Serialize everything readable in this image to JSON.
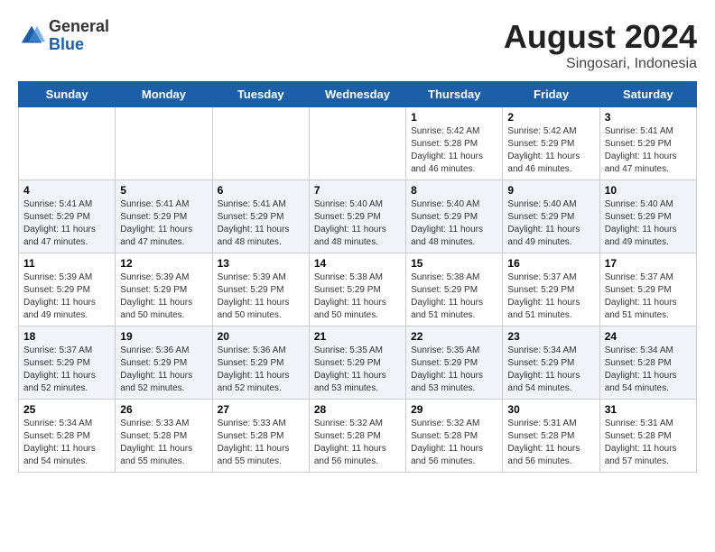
{
  "header": {
    "logo_general": "General",
    "logo_blue": "Blue",
    "month_title": "August 2024",
    "location": "Singosari, Indonesia"
  },
  "days_of_week": [
    "Sunday",
    "Monday",
    "Tuesday",
    "Wednesday",
    "Thursday",
    "Friday",
    "Saturday"
  ],
  "weeks": [
    [
      {
        "day": "",
        "info": ""
      },
      {
        "day": "",
        "info": ""
      },
      {
        "day": "",
        "info": ""
      },
      {
        "day": "",
        "info": ""
      },
      {
        "day": "1",
        "info": "Sunrise: 5:42 AM\nSunset: 5:28 PM\nDaylight: 11 hours and 46 minutes."
      },
      {
        "day": "2",
        "info": "Sunrise: 5:42 AM\nSunset: 5:29 PM\nDaylight: 11 hours and 46 minutes."
      },
      {
        "day": "3",
        "info": "Sunrise: 5:41 AM\nSunset: 5:29 PM\nDaylight: 11 hours and 47 minutes."
      }
    ],
    [
      {
        "day": "4",
        "info": "Sunrise: 5:41 AM\nSunset: 5:29 PM\nDaylight: 11 hours and 47 minutes."
      },
      {
        "day": "5",
        "info": "Sunrise: 5:41 AM\nSunset: 5:29 PM\nDaylight: 11 hours and 47 minutes."
      },
      {
        "day": "6",
        "info": "Sunrise: 5:41 AM\nSunset: 5:29 PM\nDaylight: 11 hours and 48 minutes."
      },
      {
        "day": "7",
        "info": "Sunrise: 5:40 AM\nSunset: 5:29 PM\nDaylight: 11 hours and 48 minutes."
      },
      {
        "day": "8",
        "info": "Sunrise: 5:40 AM\nSunset: 5:29 PM\nDaylight: 11 hours and 48 minutes."
      },
      {
        "day": "9",
        "info": "Sunrise: 5:40 AM\nSunset: 5:29 PM\nDaylight: 11 hours and 49 minutes."
      },
      {
        "day": "10",
        "info": "Sunrise: 5:40 AM\nSunset: 5:29 PM\nDaylight: 11 hours and 49 minutes."
      }
    ],
    [
      {
        "day": "11",
        "info": "Sunrise: 5:39 AM\nSunset: 5:29 PM\nDaylight: 11 hours and 49 minutes."
      },
      {
        "day": "12",
        "info": "Sunrise: 5:39 AM\nSunset: 5:29 PM\nDaylight: 11 hours and 50 minutes."
      },
      {
        "day": "13",
        "info": "Sunrise: 5:39 AM\nSunset: 5:29 PM\nDaylight: 11 hours and 50 minutes."
      },
      {
        "day": "14",
        "info": "Sunrise: 5:38 AM\nSunset: 5:29 PM\nDaylight: 11 hours and 50 minutes."
      },
      {
        "day": "15",
        "info": "Sunrise: 5:38 AM\nSunset: 5:29 PM\nDaylight: 11 hours and 51 minutes."
      },
      {
        "day": "16",
        "info": "Sunrise: 5:37 AM\nSunset: 5:29 PM\nDaylight: 11 hours and 51 minutes."
      },
      {
        "day": "17",
        "info": "Sunrise: 5:37 AM\nSunset: 5:29 PM\nDaylight: 11 hours and 51 minutes."
      }
    ],
    [
      {
        "day": "18",
        "info": "Sunrise: 5:37 AM\nSunset: 5:29 PM\nDaylight: 11 hours and 52 minutes."
      },
      {
        "day": "19",
        "info": "Sunrise: 5:36 AM\nSunset: 5:29 PM\nDaylight: 11 hours and 52 minutes."
      },
      {
        "day": "20",
        "info": "Sunrise: 5:36 AM\nSunset: 5:29 PM\nDaylight: 11 hours and 52 minutes."
      },
      {
        "day": "21",
        "info": "Sunrise: 5:35 AM\nSunset: 5:29 PM\nDaylight: 11 hours and 53 minutes."
      },
      {
        "day": "22",
        "info": "Sunrise: 5:35 AM\nSunset: 5:29 PM\nDaylight: 11 hours and 53 minutes."
      },
      {
        "day": "23",
        "info": "Sunrise: 5:34 AM\nSunset: 5:29 PM\nDaylight: 11 hours and 54 minutes."
      },
      {
        "day": "24",
        "info": "Sunrise: 5:34 AM\nSunset: 5:28 PM\nDaylight: 11 hours and 54 minutes."
      }
    ],
    [
      {
        "day": "25",
        "info": "Sunrise: 5:34 AM\nSunset: 5:28 PM\nDaylight: 11 hours and 54 minutes."
      },
      {
        "day": "26",
        "info": "Sunrise: 5:33 AM\nSunset: 5:28 PM\nDaylight: 11 hours and 55 minutes."
      },
      {
        "day": "27",
        "info": "Sunrise: 5:33 AM\nSunset: 5:28 PM\nDaylight: 11 hours and 55 minutes."
      },
      {
        "day": "28",
        "info": "Sunrise: 5:32 AM\nSunset: 5:28 PM\nDaylight: 11 hours and 56 minutes."
      },
      {
        "day": "29",
        "info": "Sunrise: 5:32 AM\nSunset: 5:28 PM\nDaylight: 11 hours and 56 minutes."
      },
      {
        "day": "30",
        "info": "Sunrise: 5:31 AM\nSunset: 5:28 PM\nDaylight: 11 hours and 56 minutes."
      },
      {
        "day": "31",
        "info": "Sunrise: 5:31 AM\nSunset: 5:28 PM\nDaylight: 11 hours and 57 minutes."
      }
    ]
  ]
}
